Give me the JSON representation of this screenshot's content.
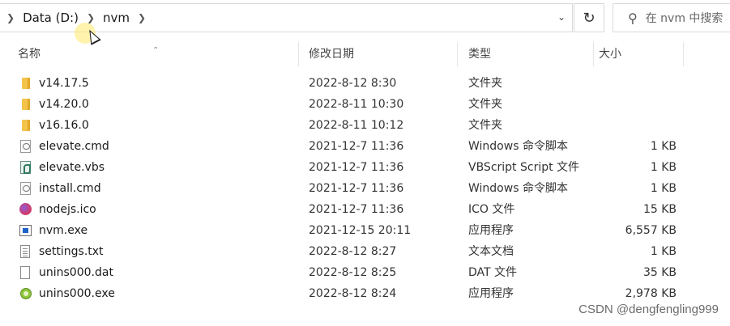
{
  "address_bar": {
    "breadcrumbs": [
      "Data (D:)",
      "nvm"
    ],
    "search_placeholder": "在 nvm 中搜索"
  },
  "columns": {
    "name": "名称",
    "date": "修改日期",
    "type": "类型",
    "size": "大小"
  },
  "files": [
    {
      "name": "v14.17.5",
      "date": "2022-8-12 8:30",
      "type": "文件夹",
      "size": "",
      "icon": "folder"
    },
    {
      "name": "v14.20.0",
      "date": "2022-8-11 10:30",
      "type": "文件夹",
      "size": "",
      "icon": "folder"
    },
    {
      "name": "v16.16.0",
      "date": "2022-8-11 10:12",
      "type": "文件夹",
      "size": "",
      "icon": "folder"
    },
    {
      "name": "elevate.cmd",
      "date": "2021-12-7 11:36",
      "type": "Windows 命令脚本",
      "size": "1 KB",
      "icon": "doc"
    },
    {
      "name": "elevate.vbs",
      "date": "2021-12-7 11:36",
      "type": "VBScript Script 文件",
      "size": "1 KB",
      "icon": "vbs"
    },
    {
      "name": "install.cmd",
      "date": "2021-12-7 11:36",
      "type": "Windows 命令脚本",
      "size": "1 KB",
      "icon": "doc"
    },
    {
      "name": "nodejs.ico",
      "date": "2021-12-7 11:36",
      "type": "ICO 文件",
      "size": "15 KB",
      "icon": "node"
    },
    {
      "name": "nvm.exe",
      "date": "2021-12-15 20:11",
      "type": "应用程序",
      "size": "6,557 KB",
      "icon": "exe"
    },
    {
      "name": "settings.txt",
      "date": "2022-8-12 8:27",
      "type": "文本文档",
      "size": "1 KB",
      "icon": "txt"
    },
    {
      "name": "unins000.dat",
      "date": "2022-8-12 8:25",
      "type": "DAT 文件",
      "size": "35 KB",
      "icon": "dat"
    },
    {
      "name": "unins000.exe",
      "date": "2022-8-12 8:24",
      "type": "应用程序",
      "size": "2,978 KB",
      "icon": "uexe"
    }
  ],
  "watermark": "CSDN @dengfengling999"
}
